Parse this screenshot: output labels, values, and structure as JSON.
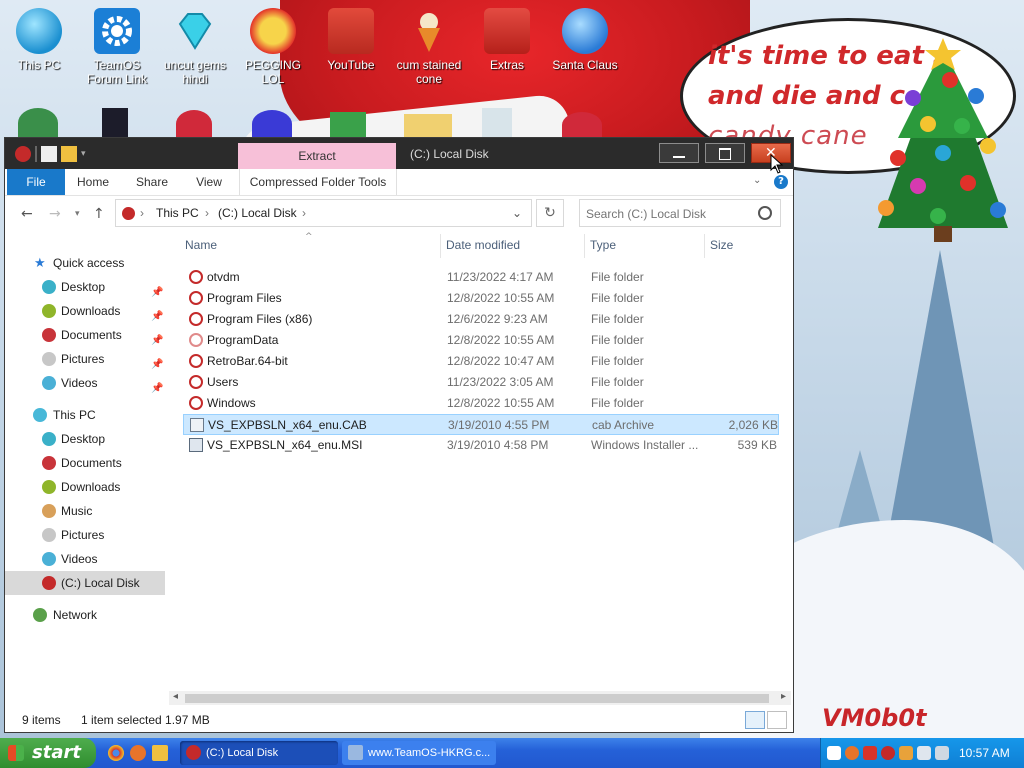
{
  "desktop": {
    "icons": [
      {
        "label": "This PC",
        "icon": "computer-icon"
      },
      {
        "label": "TeamOS Forum Link",
        "icon": "gear-icon"
      },
      {
        "label": "uncut gems hindi",
        "icon": "diamond-icon"
      },
      {
        "label": "PEGGING LOL",
        "icon": "p-logo-icon"
      },
      {
        "label": "YouTube",
        "icon": "angry-bird-icon"
      },
      {
        "label": "cum stained cone",
        "icon": "ice-cream-cone-icon"
      },
      {
        "label": "Extras",
        "icon": "extras-icon"
      },
      {
        "label": "Santa Claus",
        "icon": "ornament-icon"
      }
    ],
    "speech_bubble": {
      "line1": "it's time to eat s",
      "line2": "and die and c",
      "line3": "candy cane"
    },
    "watermark": "VM0b0t"
  },
  "window": {
    "title": "(C:) Local Disk",
    "context_tab": "Extract",
    "ribbon_tabs": {
      "file": "File",
      "home": "Home",
      "share": "Share",
      "view": "View",
      "compressed": "Compressed Folder Tools"
    },
    "address": {
      "part1": "This PC",
      "part2": "(C:) Local Disk"
    },
    "search": {
      "placeholder": "Search (C:) Local Disk"
    },
    "nav": {
      "quick_access": "Quick access",
      "qa_desktop": "Desktop",
      "qa_downloads": "Downloads",
      "qa_documents": "Documents",
      "qa_pictures": "Pictures",
      "qa_videos": "Videos",
      "this_pc": "This PC",
      "pc_desktop": "Desktop",
      "pc_documents": "Documents",
      "pc_downloads": "Downloads",
      "pc_music": "Music",
      "pc_pictures": "Pictures",
      "pc_videos": "Videos",
      "pc_local_disk": "(C:) Local Disk",
      "network": "Network"
    },
    "columns": {
      "name": "Name",
      "date": "Date modified",
      "type": "Type",
      "size": "Size"
    },
    "files": [
      {
        "name": "otvdm",
        "date": "11/23/2022 4:17 AM",
        "type": "File folder",
        "size": ""
      },
      {
        "name": "Program Files",
        "date": "12/8/2022 10:55 AM",
        "type": "File folder",
        "size": ""
      },
      {
        "name": "Program Files (x86)",
        "date": "12/6/2022 9:23 AM",
        "type": "File folder",
        "size": ""
      },
      {
        "name": "ProgramData",
        "date": "12/8/2022 10:55 AM",
        "type": "File folder",
        "size": ""
      },
      {
        "name": "RetroBar.64-bit",
        "date": "12/8/2022 10:47 AM",
        "type": "File folder",
        "size": ""
      },
      {
        "name": "Users",
        "date": "11/23/2022 3:05 AM",
        "type": "File folder",
        "size": ""
      },
      {
        "name": "Windows",
        "date": "12/8/2022 10:55 AM",
        "type": "File folder",
        "size": ""
      },
      {
        "name": "VS_EXPBSLN_x64_enu.CAB",
        "date": "3/19/2010 4:55 PM",
        "type": "cab Archive",
        "size": "2,026 KB"
      },
      {
        "name": "VS_EXPBSLN_x64_enu.MSI",
        "date": "3/19/2010 4:58 PM",
        "type": "Windows Installer ...",
        "size": "539 KB"
      }
    ],
    "status": {
      "count": "9 items",
      "selected": "1 item selected  1.97 MB"
    }
  },
  "taskbar": {
    "start": "start",
    "task_explorer": "(C:) Local Disk",
    "task_browser": "www.TeamOS-HKRG.c...",
    "clock": "10:57 AM"
  },
  "colors": {
    "accent": "#1979ca",
    "selection": "#cce8ff",
    "taskbar": "#2561d8",
    "start": "#3c9a3b",
    "close": "#d4502e"
  }
}
